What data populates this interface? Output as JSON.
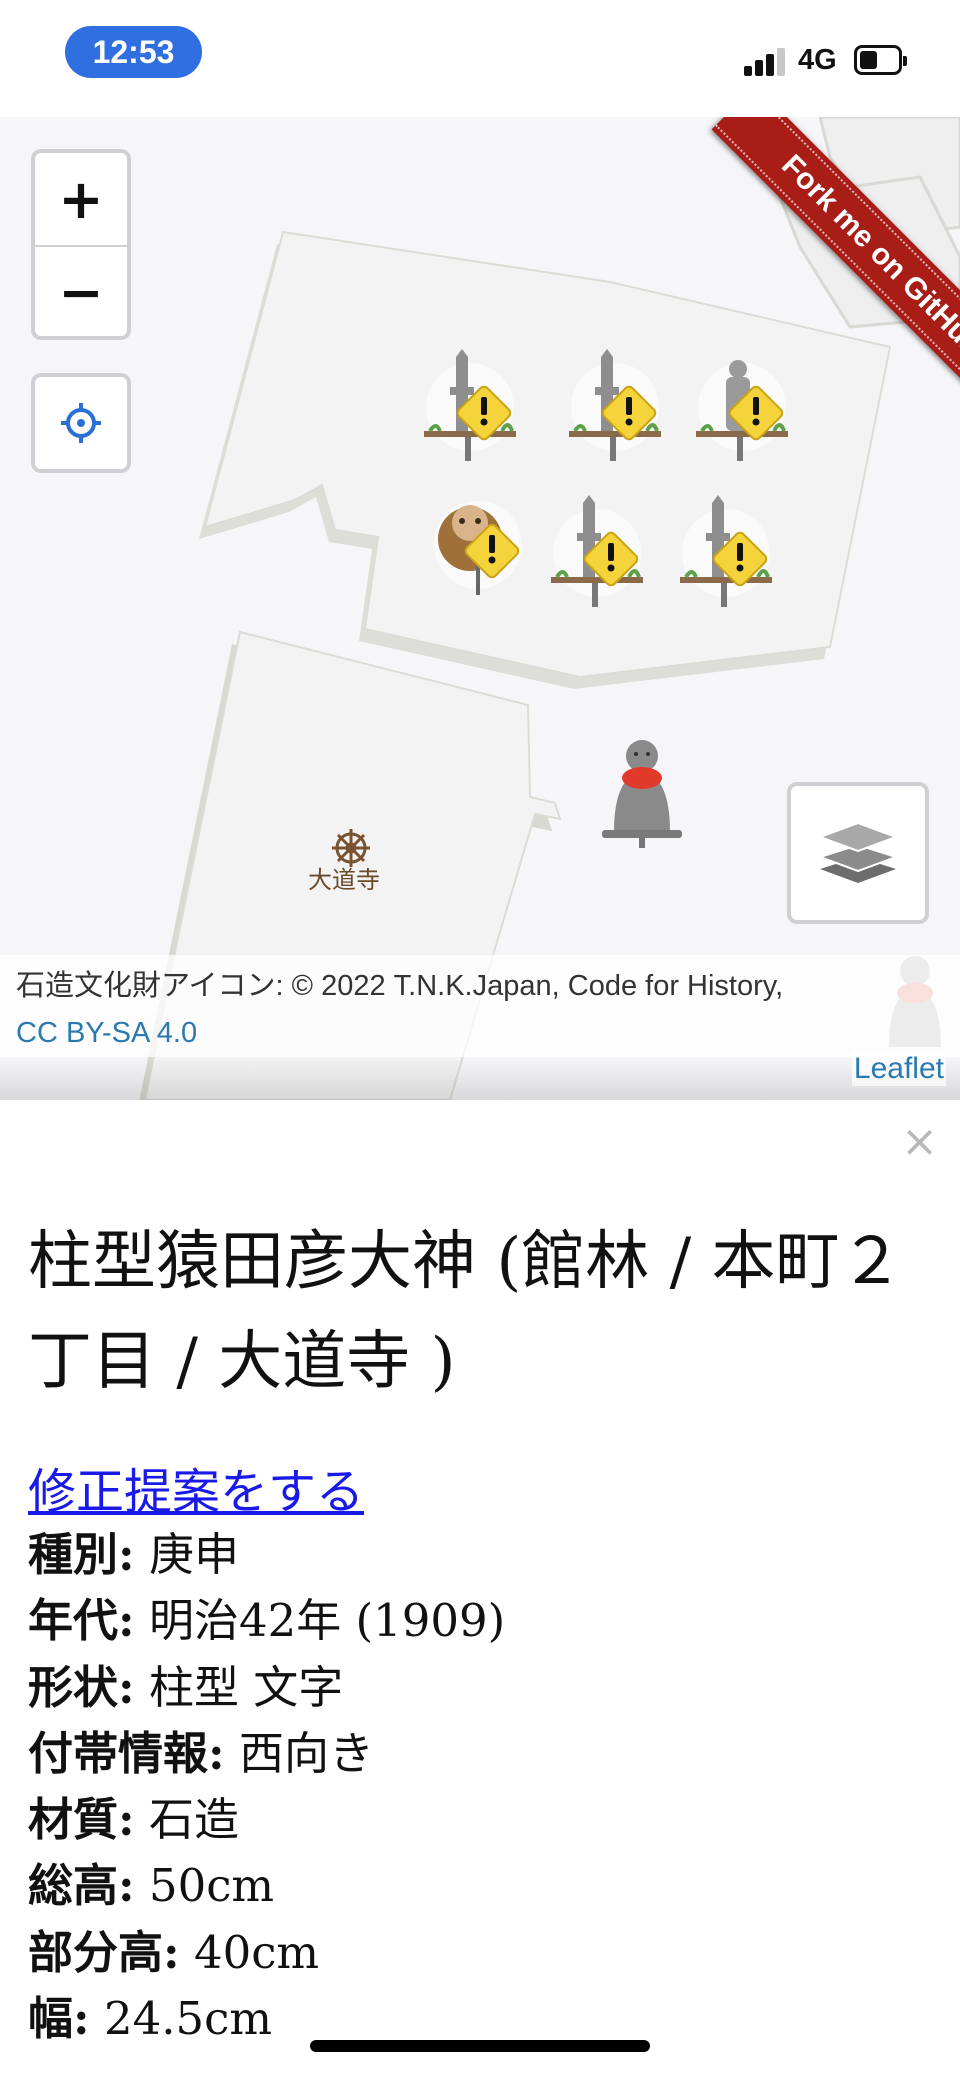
{
  "status_bar": {
    "time": "12:53",
    "network": "4G",
    "signal_bars": 3,
    "battery_level": 0.45
  },
  "map": {
    "zoom_in_label": "+",
    "zoom_out_label": "−",
    "ribbon_text": "Fork me on GitHub",
    "temple_label": "大道寺",
    "attribution_text": "石造文化財アイコン: © 2022 T.N.K.Japan, Code for History, ",
    "attribution_license": "CC BY-SA 4.0",
    "leaflet_label": "Leaflet",
    "colors": {
      "warning": "#f5d33a",
      "jizo_bib": "#e23a2a",
      "ribbon": "#a81d16",
      "link": "#2a7ab0"
    }
  },
  "panel": {
    "close_label": "×",
    "title": "柱型猿田彦大神 (館林 / 本町２丁目 / 大道寺 )",
    "suggest_link": "修正提案をする",
    "details": [
      {
        "key": "種別:",
        "value": "庚申"
      },
      {
        "key": "年代:",
        "value": "明治42年 (1909)"
      },
      {
        "key": "形状:",
        "value": "柱型 文字"
      },
      {
        "key": "付帯情報:",
        "value": "西向き"
      },
      {
        "key": "材質:",
        "value": "石造"
      },
      {
        "key": "総高:",
        "value": "50cm"
      },
      {
        "key": "部分高:",
        "value": "40cm"
      },
      {
        "key": "幅:",
        "value": "24.5cm"
      }
    ]
  }
}
